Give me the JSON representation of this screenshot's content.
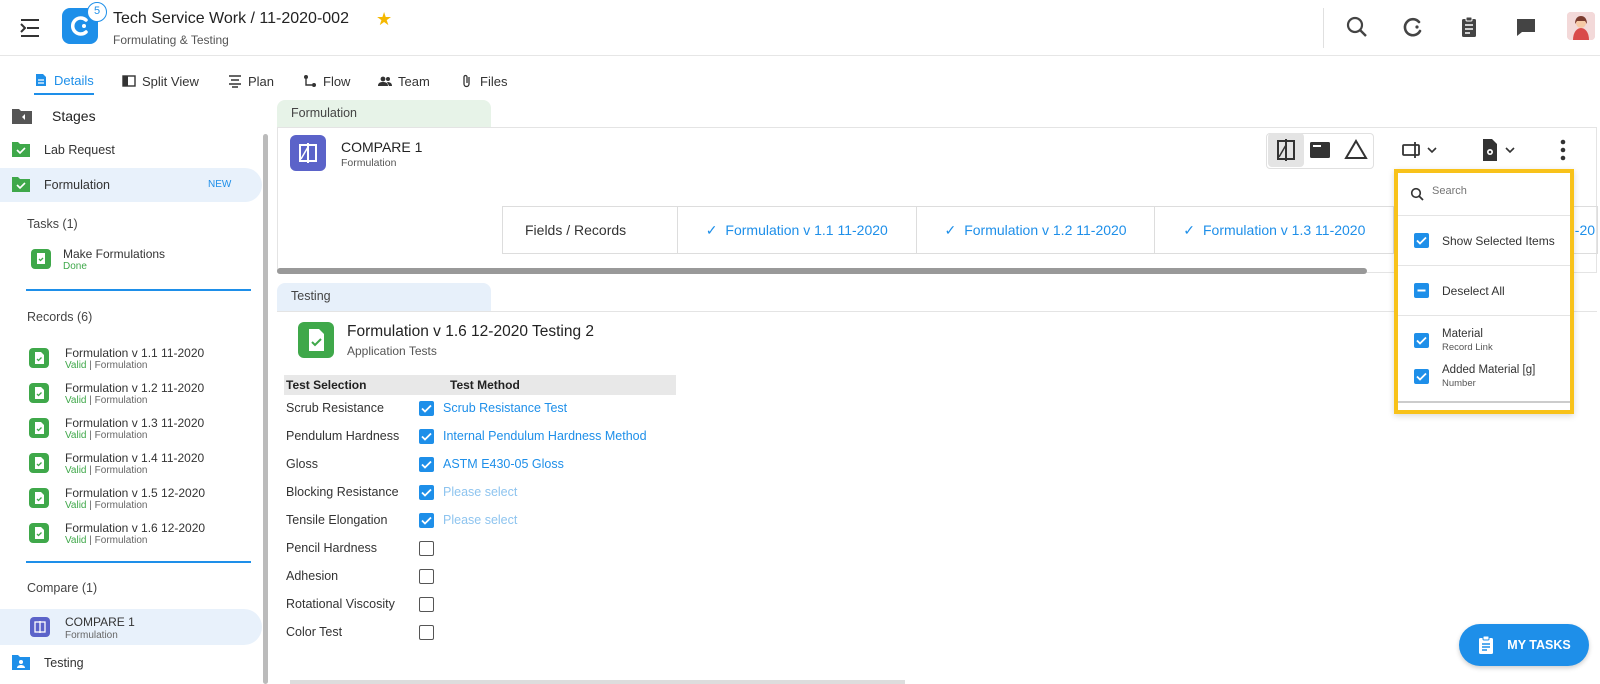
{
  "header": {
    "title": "Tech Service Work / 11-2020-002",
    "subtitle": "Formulating & Testing",
    "badge_count": "5"
  },
  "tabs": [
    {
      "label": "Details",
      "icon": "document-icon"
    },
    {
      "label": "Split View",
      "icon": "split-view-icon"
    },
    {
      "label": "Plan",
      "icon": "plan-icon"
    },
    {
      "label": "Flow",
      "icon": "flow-icon"
    },
    {
      "label": "Team",
      "icon": "team-icon"
    },
    {
      "label": "Files",
      "icon": "paperclip-icon"
    }
  ],
  "sidebar": {
    "title": "Stages",
    "stages": [
      {
        "label": "Lab Request"
      },
      {
        "label": "Formulation",
        "badge": "NEW"
      },
      {
        "label": "Testing"
      }
    ],
    "tasks_label": "Tasks (1)",
    "tasks": [
      {
        "title": "Make Formulations",
        "status": "Done"
      }
    ],
    "records_label": "Records (6)",
    "records": [
      {
        "title": "Formulation v 1.1 11-2020",
        "status": "Valid",
        "type": "| Formulation"
      },
      {
        "title": "Formulation v 1.2 11-2020",
        "status": "Valid",
        "type": "| Formulation"
      },
      {
        "title": "Formulation v 1.3 11-2020",
        "status": "Valid",
        "type": "| Formulation"
      },
      {
        "title": "Formulation v 1.4 11-2020",
        "status": "Valid",
        "type": "| Formulation"
      },
      {
        "title": "Formulation v 1.5 12-2020",
        "status": "Valid",
        "type": "| Formulation"
      },
      {
        "title": "Formulation v 1.6 12-2020",
        "status": "Valid",
        "type": "| Formulation"
      }
    ],
    "compare_label": "Compare (1)",
    "compare": {
      "title": "COMPARE 1",
      "sub": "Formulation"
    }
  },
  "formulation_tab": "Formulation",
  "compare_card": {
    "title": "COMPARE 1",
    "subtitle": "Formulation",
    "head": "Fields / Records",
    "columns": [
      "Formulation v 1.1 11-2020",
      "Formulation v 1.2 11-2020",
      "Formulation v 1.3 11-2020"
    ],
    "partial_col": "-20"
  },
  "testing_tab": "Testing",
  "testing_card": {
    "title": "Formulation v 1.6 12-2020 Testing 2",
    "subtitle": "Application Tests",
    "col_selection": "Test Selection",
    "col_method": "Test Method",
    "rows": [
      {
        "name": "Scrub Resistance",
        "checked": true,
        "method": "Scrub Resistance Test"
      },
      {
        "name": "Pendulum Hardness",
        "checked": true,
        "method": "Internal Pendulum Hardness Method"
      },
      {
        "name": "Gloss",
        "checked": true,
        "method": "ASTM E430-05 Gloss"
      },
      {
        "name": "Blocking Resistance",
        "checked": true,
        "method": "Please select",
        "placeholder": true
      },
      {
        "name": "Tensile Elongation",
        "checked": true,
        "method": "Please select",
        "placeholder": true
      },
      {
        "name": "Pencil Hardness",
        "checked": false,
        "method": ""
      },
      {
        "name": "Adhesion",
        "checked": false,
        "method": ""
      },
      {
        "name": "Rotational Viscosity",
        "checked": false,
        "method": ""
      },
      {
        "name": "Color Test",
        "checked": false,
        "method": ""
      }
    ]
  },
  "dropdown": {
    "search_placeholder": "Search",
    "show_selected": "Show Selected Items",
    "deselect_all": "Deselect All",
    "items": [
      {
        "label": "Material",
        "sub": "Record Link"
      },
      {
        "label": "Added Material [g]",
        "sub": "Number"
      }
    ]
  },
  "fab_label": "MY TASKS",
  "colors": {
    "accent": "#1e8fe9",
    "success": "#3fa84a",
    "highlight": "#f8c21a",
    "compare": "#5b63c9"
  }
}
